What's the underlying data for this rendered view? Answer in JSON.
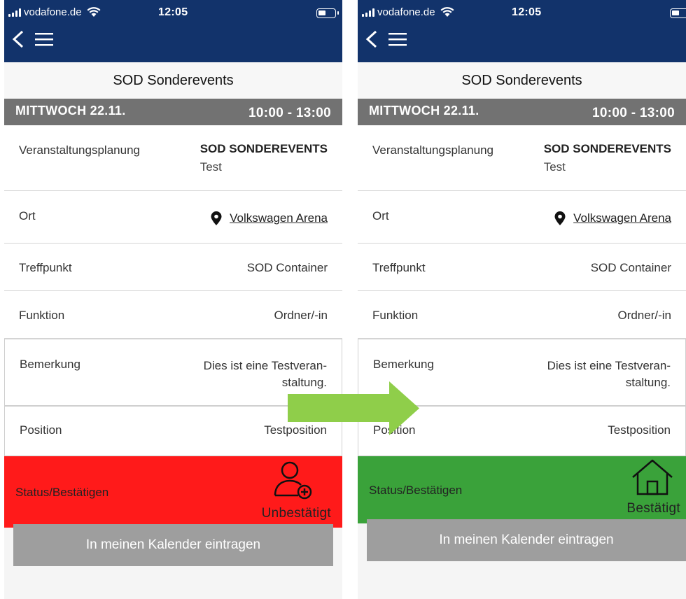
{
  "status_bar": {
    "carrier": "vodafone.de",
    "time": "12:05"
  },
  "header": {
    "back_icon": "chevron-left-icon",
    "menu_icon": "hamburger-menu-icon"
  },
  "page_title": "SOD Sonderevents",
  "date": {
    "day": "MITTWOCH 22.11.",
    "time_range": "10:00 - 13:00"
  },
  "details": {
    "plan_label": "Veranstaltungsplanung",
    "plan_value": "SOD SONDEREVENTS",
    "plan_sub": "Test",
    "ort_label": "Ort",
    "ort_value": "Volkswagen Arena",
    "treff_label": "Treffpunkt",
    "treff_value": "SOD Container",
    "funktion_label": "Funktion",
    "funktion_value": "Ordner/-in",
    "bem_label": "Bemerkung",
    "bem_line1": "Dies ist eine Testveran-",
    "bem_line2": "staltung.",
    "pos_label": "Position",
    "pos_value": "Testposition"
  },
  "status": {
    "label": "Status/Bestätigen",
    "unconfirmed": "Unbestätigt",
    "confirmed": "Bestätigt",
    "unconfirmed_color": "#ff1a1a",
    "confirmed_color": "#3aa23a"
  },
  "calendar_button": "In meinen Kalender eintragen",
  "colors": {
    "header": "#12336b",
    "date_bar": "#727272",
    "arrow": "#8fce4a",
    "button": "#9e9e9e"
  }
}
